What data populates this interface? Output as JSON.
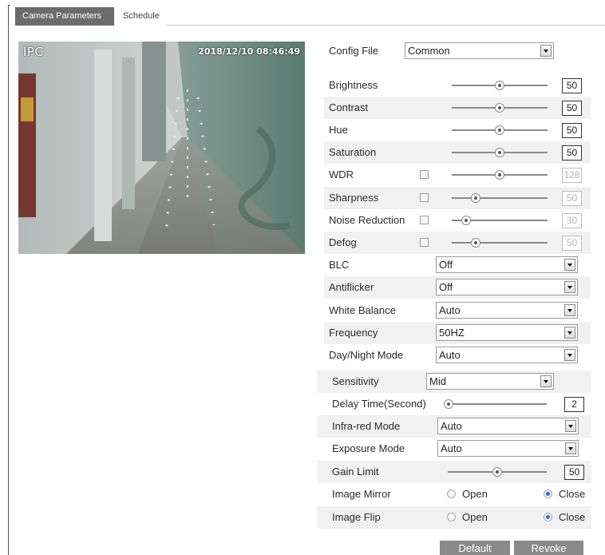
{
  "tabs": {
    "active": "Camera Parameters",
    "inactive": "Schedule"
  },
  "video": {
    "osd_name": "IPC",
    "osd_time": "2018/12/10 08:46:49"
  },
  "config_file": {
    "label": "Config File",
    "value": "Common"
  },
  "sliders": [
    {
      "label": "Brightness",
      "value": "50",
      "level": 0.5,
      "has_checkbox": false
    },
    {
      "label": "Contrast",
      "value": "50",
      "level": 0.5,
      "has_checkbox": false
    },
    {
      "label": "Hue",
      "value": "50",
      "level": 0.5,
      "has_checkbox": false
    },
    {
      "label": "Saturation",
      "value": "50",
      "level": 0.5,
      "has_checkbox": false
    },
    {
      "label": "WDR",
      "value": "128",
      "level": 0.5,
      "has_checkbox": true
    },
    {
      "label": "Sharpness",
      "value": "50",
      "level": 0.25,
      "has_checkbox": true
    },
    {
      "label": "Noise Reduction",
      "value": "30",
      "level": 0.15,
      "has_checkbox": true
    },
    {
      "label": "Defog",
      "value": "50",
      "level": 0.25,
      "has_checkbox": true
    }
  ],
  "selects": [
    {
      "label": "BLC",
      "value": "Off"
    },
    {
      "label": "Antiflicker",
      "value": "Off"
    },
    {
      "label": "White Balance",
      "value": "Auto"
    },
    {
      "label": "Frequency",
      "value": "50HZ"
    },
    {
      "label": "Day/Night Mode",
      "value": "Auto"
    }
  ],
  "day_night": {
    "sensitivity": {
      "label": "Sensitivity",
      "value": "Mid"
    },
    "delay_time": {
      "label": "Delay Time(Second)",
      "value": "2",
      "level": 0.0
    },
    "infrared_mode": {
      "label": "Infra-red Mode",
      "value": "Auto"
    },
    "exposure_mode": {
      "label": "Exposure Mode",
      "value": "Auto"
    },
    "gain_limit": {
      "label": "Gain Limit",
      "value": "50",
      "level": 0.5
    },
    "image_mirror": {
      "label": "Image Mirror",
      "open": "Open",
      "close": "Close",
      "selected": "Close"
    },
    "image_flip": {
      "label": "Image Flip",
      "open": "Open",
      "close": "Close",
      "selected": "Close"
    }
  },
  "buttons": {
    "default": "Default",
    "revoke": "Revoke"
  },
  "colors": {
    "tab_active_bg": "#6b6b6b",
    "button_bg": "#8a8a8a",
    "radio_selected": "#1f6fd6",
    "row_stripe": "#f1f1f1"
  }
}
